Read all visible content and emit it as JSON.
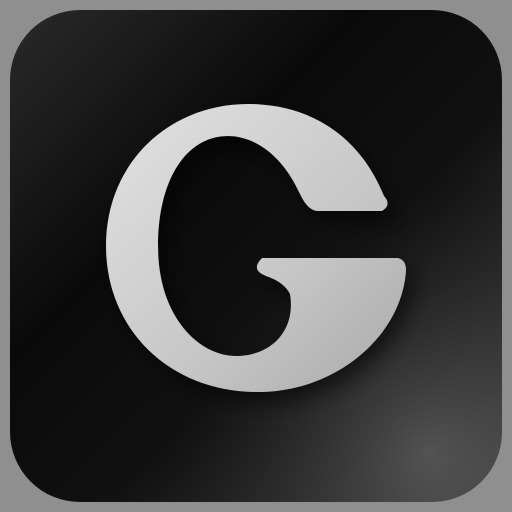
{
  "app_icon": {
    "name": "G app icon",
    "letter": "G",
    "colors": {
      "tile_dark": "#000000",
      "tile_mid": "#111111",
      "tile_light": "#5a5a5a",
      "glyph": "#cfcfcf",
      "glyph_shadow": "#8a8a8a",
      "outer_bg": "#9a9a9a"
    }
  }
}
